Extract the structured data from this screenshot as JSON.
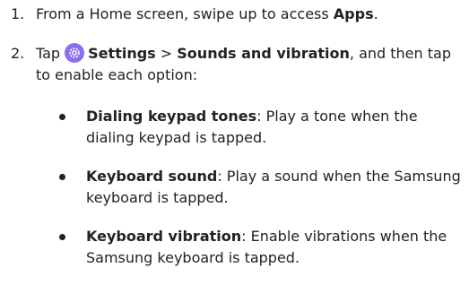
{
  "steps": [
    {
      "number": "1.",
      "text_before": "From a Home screen, swipe up to access ",
      "bold": "Apps",
      "text_after": "."
    },
    {
      "number": "2.",
      "tap": "Tap ",
      "icon": "settings-gear-icon",
      "settings": "Settings",
      "separator": " > ",
      "sounds": "Sounds and vibration",
      "text_after": ", and then tap to enable each option:"
    }
  ],
  "options": [
    {
      "title": "Dialing keypad tones",
      "desc": ": Play a tone when the dialing keypad is tapped."
    },
    {
      "title": "Keyboard sound",
      "desc": ": Play a sound when the Samsung keyboard is tapped."
    },
    {
      "title": "Keyboard vibration",
      "desc": ": Enable vibrations when the Samsung keyboard is tapped."
    }
  ],
  "colors": {
    "text": "#222222",
    "icon_background": "#8a6ff0"
  }
}
